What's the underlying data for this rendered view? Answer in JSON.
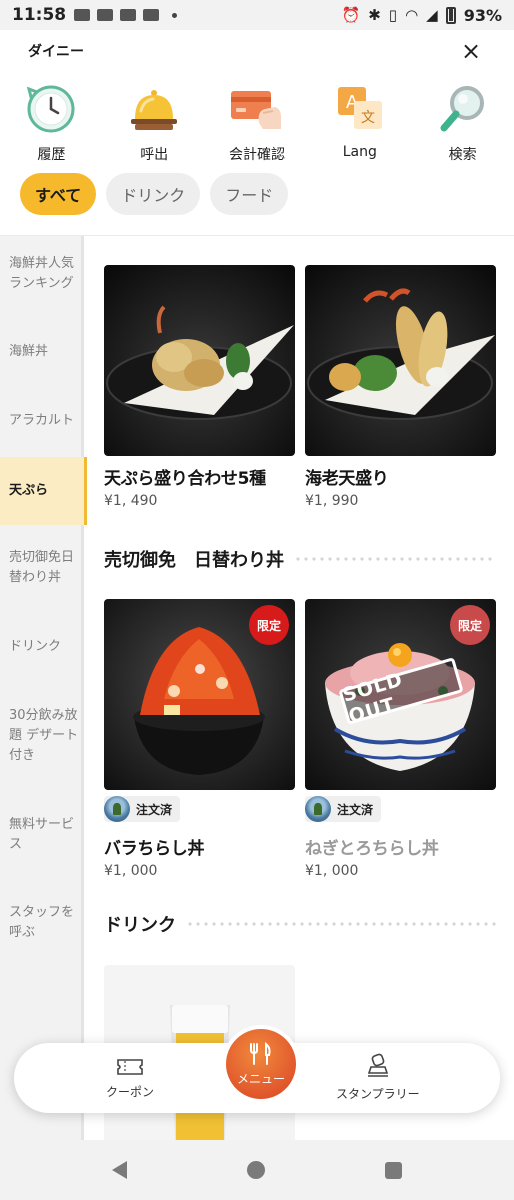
{
  "status_bar": {
    "time": "11:58",
    "battery": "93%"
  },
  "header": {
    "title": "ダイニー",
    "close_label": "×"
  },
  "quick_actions": [
    {
      "label": "履歴",
      "icon": "clock-history-icon"
    },
    {
      "label": "呼出",
      "icon": "service-bell-icon"
    },
    {
      "label": "会計確認",
      "icon": "credit-card-icon"
    },
    {
      "label": "Lang",
      "icon": "translate-icon"
    },
    {
      "label": "検索",
      "icon": "magnifier-icon"
    }
  ],
  "tabs": [
    {
      "label": "すべて",
      "active": true
    },
    {
      "label": "ドリンク",
      "active": false
    },
    {
      "label": "フード",
      "active": false
    }
  ],
  "sidebar": {
    "items": [
      {
        "label": "海鮮丼人気ランキング",
        "active": false
      },
      {
        "label": "海鮮丼",
        "active": false
      },
      {
        "label": "アラカルト",
        "active": false
      },
      {
        "label": "天ぷら",
        "active": true
      },
      {
        "label": "売切御免日替わり丼",
        "active": false
      },
      {
        "label": "ドリンク",
        "active": false
      },
      {
        "label": "30分飲み放題 デザート付き",
        "active": false
      },
      {
        "label": "無料サービス",
        "active": false
      },
      {
        "label": "スタッフを呼ぶ",
        "active": false
      }
    ]
  },
  "menu": {
    "tempura_items": [
      {
        "name": "天ぷら盛り合わせ5種",
        "price": "¥1, 490"
      },
      {
        "name": "海老天盛り",
        "price": "¥1, 990"
      }
    ],
    "daily_section_title": "売切御免　日替わり丼",
    "daily_items": [
      {
        "name": "バラちらし丼",
        "price": "¥1, 000",
        "badge": "限定",
        "ordered": "注文済",
        "sold_out": false
      },
      {
        "name": "ねぎとろちらし丼",
        "price": "¥1, 000",
        "badge": "限定",
        "ordered": "注文済",
        "sold_out": true,
        "sold_out_label": "SOLD OUT"
      }
    ],
    "drink_section_title": "ドリンク"
  },
  "bottom_nav": {
    "coupon": "クーポン",
    "menu": "メニュー",
    "stamp": "スタンプラリー"
  },
  "colors": {
    "accent": "#f5b92b",
    "menu_button": "#e1572c",
    "limited_badge": "#d71a1a"
  }
}
